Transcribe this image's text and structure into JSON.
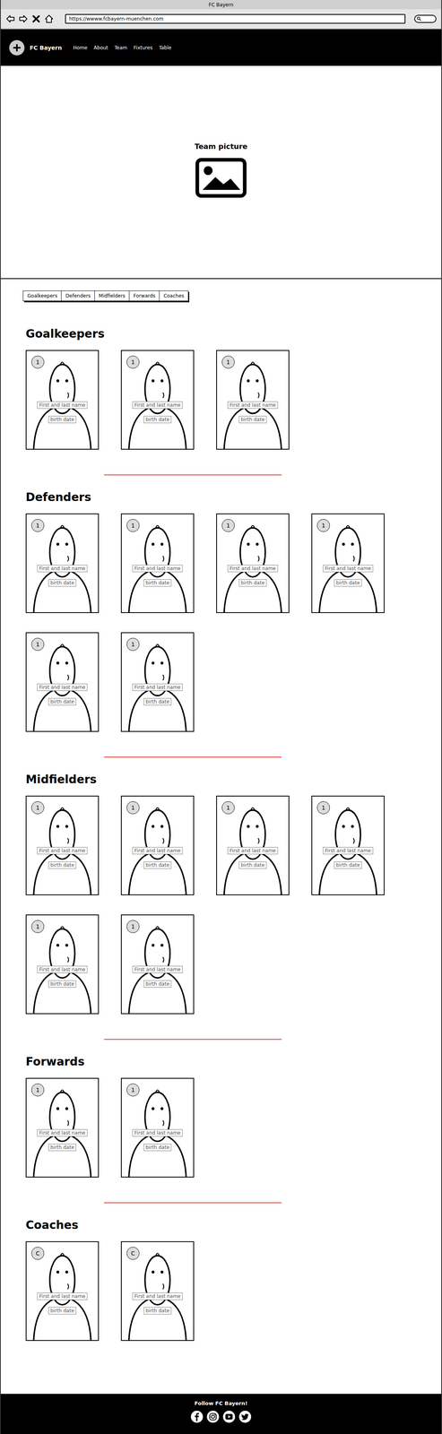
{
  "browser": {
    "title": "FC Bayern",
    "url": "https://wwww.fcbayern-muenchen.com"
  },
  "nav": {
    "brand": "FC Bayern",
    "links": [
      "Home",
      "About",
      "Team",
      "Fixtures",
      "Table"
    ]
  },
  "hero": {
    "label": "Team picture"
  },
  "tabs": [
    {
      "label": "Goalkeepers",
      "selected": false
    },
    {
      "label": "Defenders",
      "selected": false
    },
    {
      "label": "Midfielders",
      "selected": false
    },
    {
      "label": "Forwards",
      "selected": false
    },
    {
      "label": "Coaches",
      "selected": false
    }
  ],
  "sections": [
    {
      "title": "Goalkeepers",
      "members": [
        {
          "badge": "1",
          "name": "First and last name",
          "birth": "birth date"
        },
        {
          "badge": "1",
          "name": "First and last name",
          "birth": "birth date"
        },
        {
          "badge": "1",
          "name": "First and last name",
          "birth": "birth date"
        }
      ]
    },
    {
      "title": "Defenders",
      "members": [
        {
          "badge": "1",
          "name": "First and last name",
          "birth": "birth date"
        },
        {
          "badge": "1",
          "name": "First and last name",
          "birth": "birth date"
        },
        {
          "badge": "1",
          "name": "First and last name",
          "birth": "birth date"
        },
        {
          "badge": "1",
          "name": "First and last name",
          "birth": "birth date"
        },
        {
          "badge": "1",
          "name": "First and last name",
          "birth": "birth date"
        },
        {
          "badge": "1",
          "name": "First and last name",
          "birth": "birth date"
        }
      ]
    },
    {
      "title": "Midfielders",
      "members": [
        {
          "badge": "1",
          "name": "First and last name",
          "birth": "birth date"
        },
        {
          "badge": "1",
          "name": "First and last name",
          "birth": "birth date"
        },
        {
          "badge": "1",
          "name": "First and last name",
          "birth": "birth date"
        },
        {
          "badge": "1",
          "name": "First and last name",
          "birth": "birth date"
        },
        {
          "badge": "1",
          "name": "First and last name",
          "birth": "birth date"
        },
        {
          "badge": "1",
          "name": "First and last name",
          "birth": "birth date"
        }
      ]
    },
    {
      "title": "Forwards",
      "members": [
        {
          "badge": "1",
          "name": "First and last name",
          "birth": "birth date"
        },
        {
          "badge": "1",
          "name": "First and last name",
          "birth": "birth date"
        }
      ]
    },
    {
      "title": "Coaches",
      "members": [
        {
          "badge": "C",
          "name": "First and last name",
          "birth": "birth date"
        },
        {
          "badge": "C",
          "name": "First and last name",
          "birth": "birth date"
        }
      ]
    }
  ],
  "footer": {
    "text": "Follow FC Bayern!"
  }
}
